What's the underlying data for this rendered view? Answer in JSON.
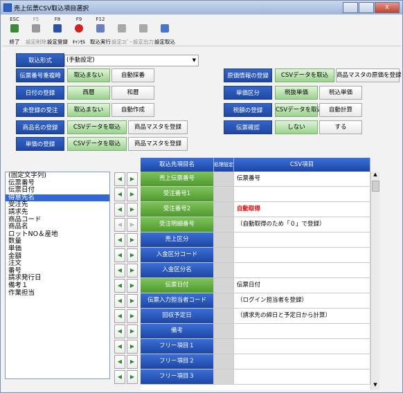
{
  "window": {
    "title": "売上伝票CSV取込項目選択",
    "controls": [
      "",
      "",
      "X"
    ]
  },
  "toolbar": [
    {
      "key": "ESC",
      "label": "終了",
      "icon": "exit-icon",
      "enabled": true
    },
    {
      "key": "F5",
      "label": "設定削除",
      "icon": "delete-icon",
      "enabled": false
    },
    {
      "key": "F8",
      "label": "設定登録",
      "icon": "save-icon",
      "enabled": true
    },
    {
      "key": "F9",
      "label": "ｷｬﾝｾﾙ",
      "icon": "cancel-icon",
      "enabled": true
    },
    {
      "key": "F12",
      "label": "取込実行",
      "icon": "execute-icon",
      "enabled": true
    },
    {
      "key": "",
      "label": "設定ｺﾋﾟｰ",
      "icon": "copy-icon",
      "enabled": false
    },
    {
      "key": "",
      "label": "設定出力",
      "icon": "export-icon",
      "enabled": false
    },
    {
      "key": "",
      "label": "設定取込",
      "icon": "import-icon",
      "enabled": true
    }
  ],
  "settings": {
    "import_format": {
      "label": "取込形式",
      "value": "(手動設定)"
    },
    "slip_number_duplicate": {
      "label": "伝票番号重複時",
      "options": [
        "取込まない",
        "自動採番"
      ],
      "selected": 0
    },
    "date_registration": {
      "label": "日付の登録",
      "options": [
        "西暦",
        "和暦"
      ],
      "selected": 0
    },
    "unregistered_order": {
      "label": "未登録の受注",
      "options": [
        "取込まない",
        "自動作成"
      ],
      "selected": 0
    },
    "product_name": {
      "label": "商品名の登録",
      "options": [
        "CSVデータを取込",
        "商品マスタを登録"
      ],
      "selected": 0
    },
    "unit_price": {
      "label": "単価の登録",
      "options": [
        "CSVデータを取込",
        "商品マスタを登録"
      ],
      "selected": 0
    },
    "cost_info": {
      "label": "原価情報の登録",
      "options": [
        "CSVデータを取込",
        "商品マスタの原価を登録"
      ],
      "selected": 0
    },
    "unit_price_type": {
      "label": "単価区分",
      "options": [
        "税抜単価",
        "税込単価"
      ],
      "selected": 0
    },
    "tax_amount": {
      "label": "税額の登録",
      "options": [
        "CSVデータを取込",
        "自動計算"
      ],
      "selected": 0
    },
    "slip_confirm": {
      "label": "伝票確認",
      "options": [
        "しない",
        "する"
      ],
      "selected": 0
    }
  },
  "source_list": {
    "items": [
      "(固定文字列)",
      "伝票番号",
      "伝票日付",
      "得意先名",
      "受注先",
      "請求先",
      "商品コード",
      "商品名",
      "ロットNO＆産地",
      "数量",
      "単価",
      "金額",
      "注文",
      "番号",
      "請求発行日",
      "備考１",
      "作業担当"
    ],
    "selected_index": 3
  },
  "mapping_grid": {
    "headers": {
      "target": "取込先項目名",
      "process": "処理設定",
      "csv": "CSV項目"
    },
    "rows": [
      {
        "target": "売上伝票番号",
        "csv": "伝票番号",
        "color": "green",
        "right_enabled": true,
        "csv_red": false
      },
      {
        "target": "受注番号1",
        "csv": "",
        "color": "green",
        "right_enabled": true,
        "csv_red": false
      },
      {
        "target": "受注番号2",
        "csv": "自動取得",
        "color": "green",
        "right_enabled": true,
        "csv_red": true
      },
      {
        "target": "受注明細番号",
        "csv": "（自動取得のため「０」で登録）",
        "color": "green",
        "right_enabled": false,
        "csv_red": false
      },
      {
        "target": "売上区分",
        "csv": "",
        "color": "blue",
        "right_enabled": true,
        "csv_red": false
      },
      {
        "target": "入金区分コード",
        "csv": "",
        "color": "blue",
        "right_enabled": true,
        "csv_red": false
      },
      {
        "target": "入金区分名",
        "csv": "",
        "color": "blue",
        "right_enabled": true,
        "csv_red": false
      },
      {
        "target": "伝票日付",
        "csv": "伝票日付",
        "color": "green",
        "right_enabled": true,
        "csv_red": false
      },
      {
        "target": "伝票入力担当者コード",
        "csv": "（ログイン担当者を登録）",
        "color": "blue",
        "right_enabled": true,
        "csv_red": false
      },
      {
        "target": "回収予定日",
        "csv": "（請求先の締日と予定日から計算）",
        "color": "blue",
        "right_enabled": true,
        "csv_red": false
      },
      {
        "target": "備考",
        "csv": "",
        "color": "blue",
        "right_enabled": true,
        "csv_red": false
      },
      {
        "target": "フリー項目１",
        "csv": "",
        "color": "blue",
        "right_enabled": true,
        "csv_red": false
      },
      {
        "target": "フリー項目２",
        "csv": "",
        "color": "blue",
        "right_enabled": true,
        "csv_red": false
      },
      {
        "target": "フリー項目３",
        "csv": "",
        "color": "blue",
        "right_enabled": true,
        "csv_red": false
      }
    ]
  },
  "arrows": {
    "left": "◀",
    "right": "▶"
  },
  "scrollbar": {
    "up": "▲",
    "down": "▼"
  }
}
